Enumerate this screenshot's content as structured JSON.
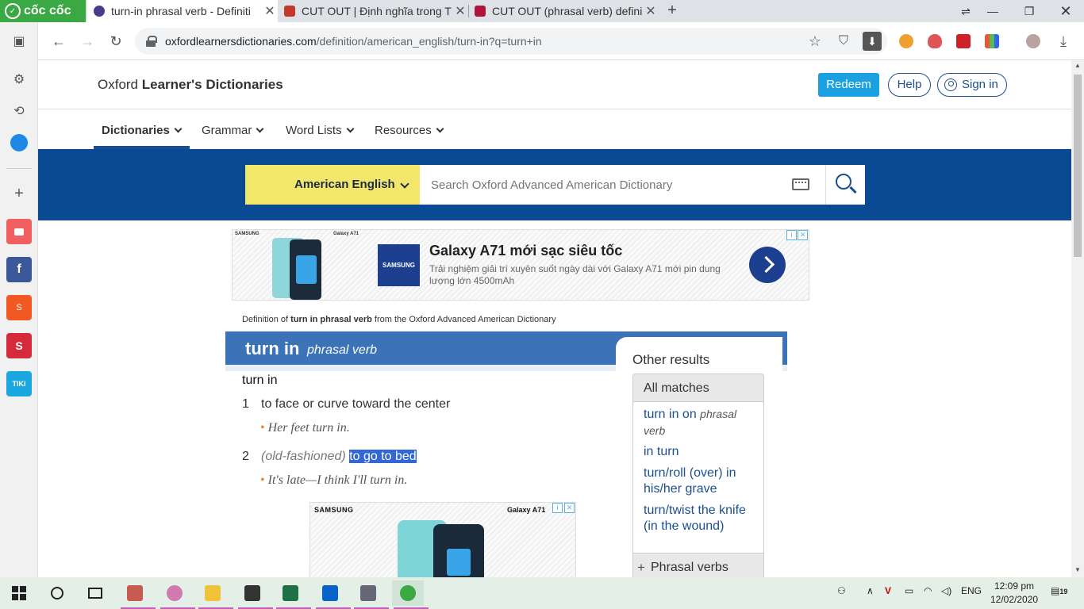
{
  "browser": {
    "brand": "cốc cốc",
    "tabs": [
      {
        "title": "turn-in phrasal verb - Definiti",
        "active": true,
        "color": "#4a3a8c"
      },
      {
        "title": "CUT OUT | Định nghĩa trong T",
        "active": false,
        "color": "#c0392b"
      },
      {
        "title": "CUT OUT (phrasal verb) defini",
        "active": false,
        "color": "#b0143c"
      }
    ],
    "url_host": "oxfordlearnersdictionaries.com",
    "url_path": "/definition/american_english/turn-in?q=turn+in"
  },
  "site": {
    "logo_plain": "Oxford ",
    "logo_bold": "Learner's Dictionaries",
    "redeem": "Redeem",
    "help": "Help",
    "signin": "Sign in",
    "nav": [
      "Dictionaries",
      "Grammar",
      "Word Lists",
      "Resources"
    ],
    "dict_select": "American English",
    "search_placeholder": "Search Oxford Advanced American Dictionary"
  },
  "ad_top": {
    "title": "Galaxy A71 mới sạc siêu tốc",
    "subtitle": "Trải nghiệm giải trí xuyên suốt ngày dài với Galaxy A71 mới pin dung lượng lớn 4500mAh",
    "logo": "SAMSUNG",
    "small_brand": "SAMSUNG",
    "small_model": "Galaxy A71"
  },
  "entry": {
    "source_pre": "Definition of ",
    "source_bold": "turn in phrasal verb",
    "source_post": " from the Oxford Advanced American Dictionary",
    "headword": "turn in",
    "pos": "phrasal verb",
    "phrase": "turn in",
    "senses": [
      {
        "num": "1",
        "label": "",
        "def": "to face or curve toward the center",
        "example": "Her feet turn in."
      },
      {
        "num": "2",
        "label": "(old-fashioned)",
        "def": "to go to bed",
        "example": "It's late—I think I'll turn in."
      }
    ]
  },
  "ad_bottom": {
    "brand": "SAMSUNG",
    "model": "Galaxy A71"
  },
  "other_results": {
    "title": "Other results",
    "all_matches": "All matches",
    "results": [
      {
        "text": "turn in on",
        "pos": "phrasal verb"
      },
      {
        "text": "in turn",
        "pos": ""
      },
      {
        "text": "turn/roll (over) in his/her grave",
        "pos": ""
      },
      {
        "text": "turn/twist the knife (in the wound)",
        "pos": ""
      }
    ],
    "phrasal_verbs": "Phrasal verbs"
  },
  "taskbar": {
    "lang": "ENG",
    "time": "12:09 pm",
    "date": "12/02/2020",
    "notif_count": "19"
  },
  "colors": {
    "accent_blue": "#0a4a94",
    "headword_bar": "#3c73b8",
    "dict_yellow": "#f2e76b",
    "link": "#1b4f8f",
    "highlight": "#3367d6"
  }
}
